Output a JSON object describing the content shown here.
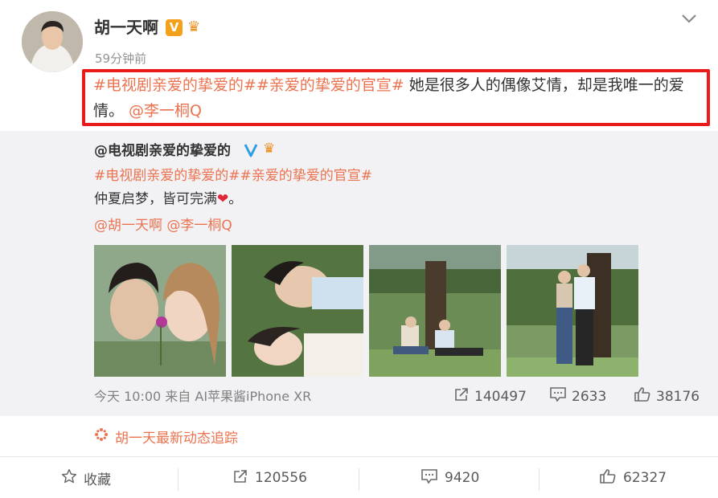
{
  "post": {
    "author": "胡一天啊",
    "time": "59分钟前",
    "text_topic": "#电视剧亲爱的挚爱的##亲爱的挚爱的官宣#",
    "text_body": " 她是很多人的偶像艾情，却是我唯一的爱情。 ",
    "text_mention": "@李一桐Q"
  },
  "repost": {
    "author": "@电视剧亲爱的挚爱的",
    "topics": "#电视剧亲爱的挚爱的##亲爱的挚爱的官宣#",
    "text": "仲夏启梦，皆可完满",
    "text_end": "。",
    "mentions": "@胡一天啊 @李一桐Q",
    "meta": "今天 10:00 来自 AI苹果酱iPhone XR",
    "reposts": "140497",
    "comments": "2633",
    "likes": "38176"
  },
  "track_link": "胡一天最新动态追踪",
  "actions": {
    "favorite": "收藏",
    "repost": "120556",
    "comment": "9420",
    "like": "62327"
  },
  "colors": {
    "accent": "#eb7350",
    "highlight_box": "#ea1b1b",
    "repost_bg": "#f2f2f5"
  },
  "icons": [
    "chevron-down-icon",
    "verified-icon",
    "crown-icon",
    "repost-icon",
    "comment-icon",
    "like-icon",
    "star-icon",
    "track-icon"
  ]
}
